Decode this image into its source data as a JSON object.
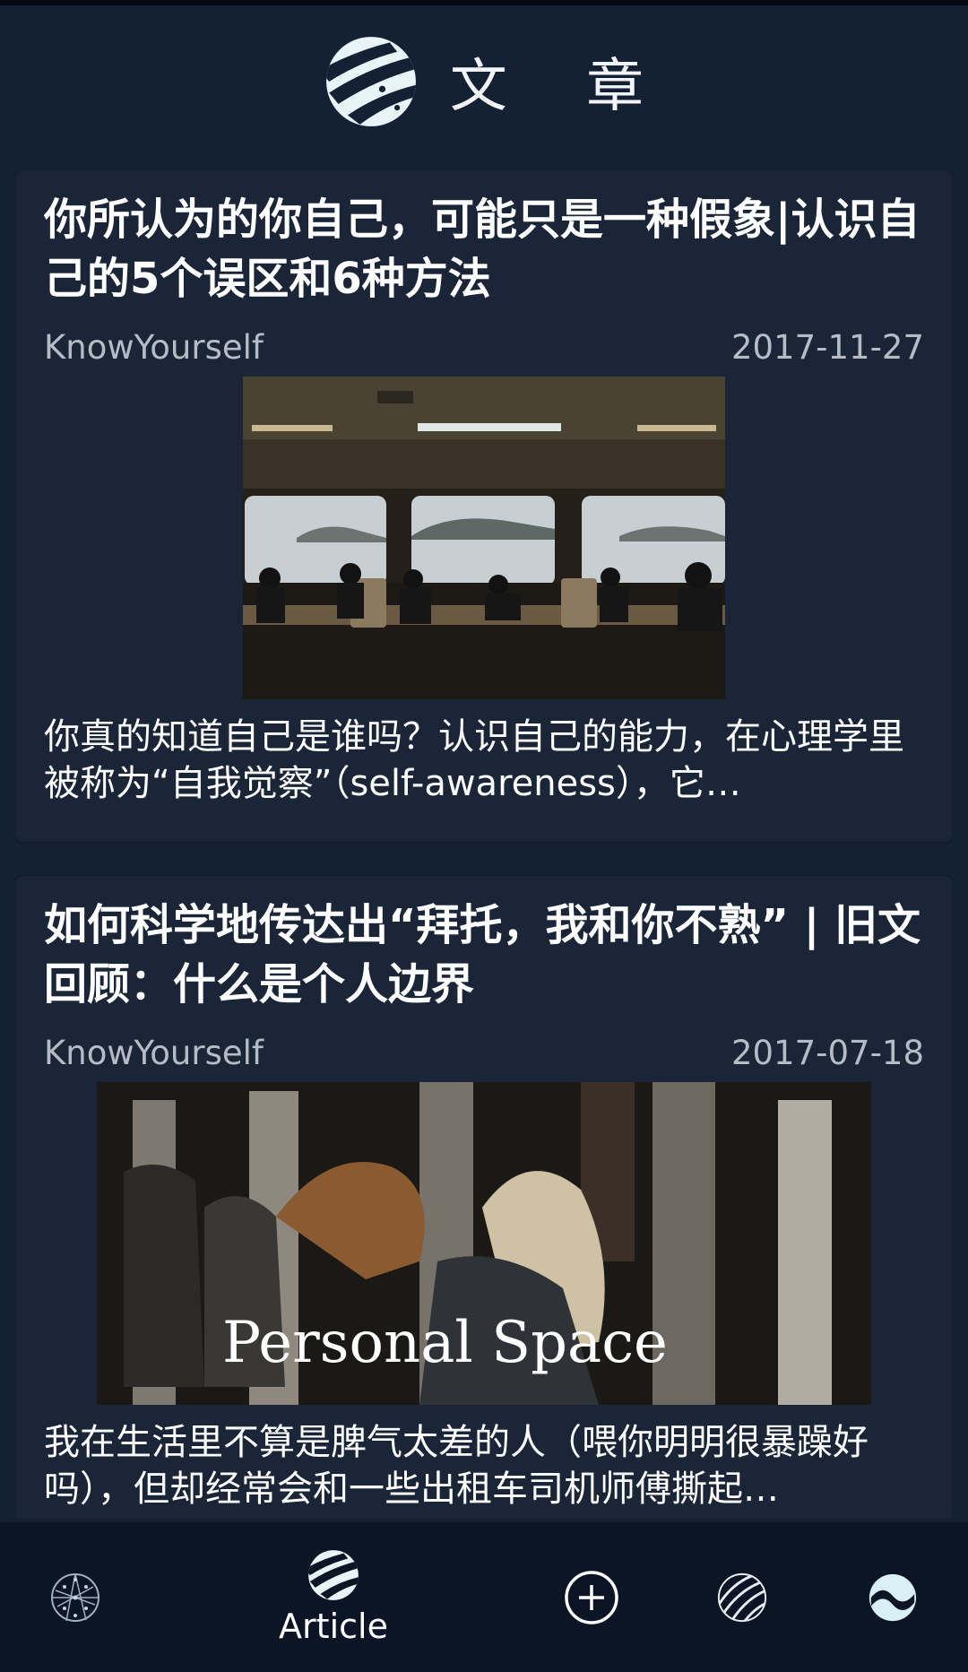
{
  "header": {
    "title": "文 章",
    "logo_icon": "striped-globe-icon"
  },
  "articles": [
    {
      "title": "你所认为的你自己，可能只是一种假象|认识自己的5个误区和6种方法",
      "author": "KnowYourself",
      "date": "2017-11-27",
      "excerpt": "你真的知道自己是谁吗？认识自己的能力，在心理学里被称为“自我觉察”（self-awareness），它…",
      "image": "ferry-cabin-photo"
    },
    {
      "title": "如何科学地传达出“拜托，我和你不熟” | 旧文回顾：什么是个人边界",
      "author": "KnowYourself",
      "date": "2017-07-18",
      "excerpt": "我在生活里不算是脾气太差的人（喂你明明很暴躁好吗），但却经常会和一些出租车司机师傅撕起…",
      "image": "personal-space-photo",
      "image_caption": "Personal Space"
    }
  ],
  "nav": {
    "items": [
      {
        "icon": "network-sphere-icon",
        "label": ""
      },
      {
        "icon": "striped-globe-icon",
        "label": "Article",
        "active": true
      },
      {
        "icon": "add-circle-icon",
        "label": ""
      },
      {
        "icon": "swirl-sphere-icon",
        "label": ""
      },
      {
        "icon": "wave-orb-icon",
        "label": ""
      }
    ]
  }
}
